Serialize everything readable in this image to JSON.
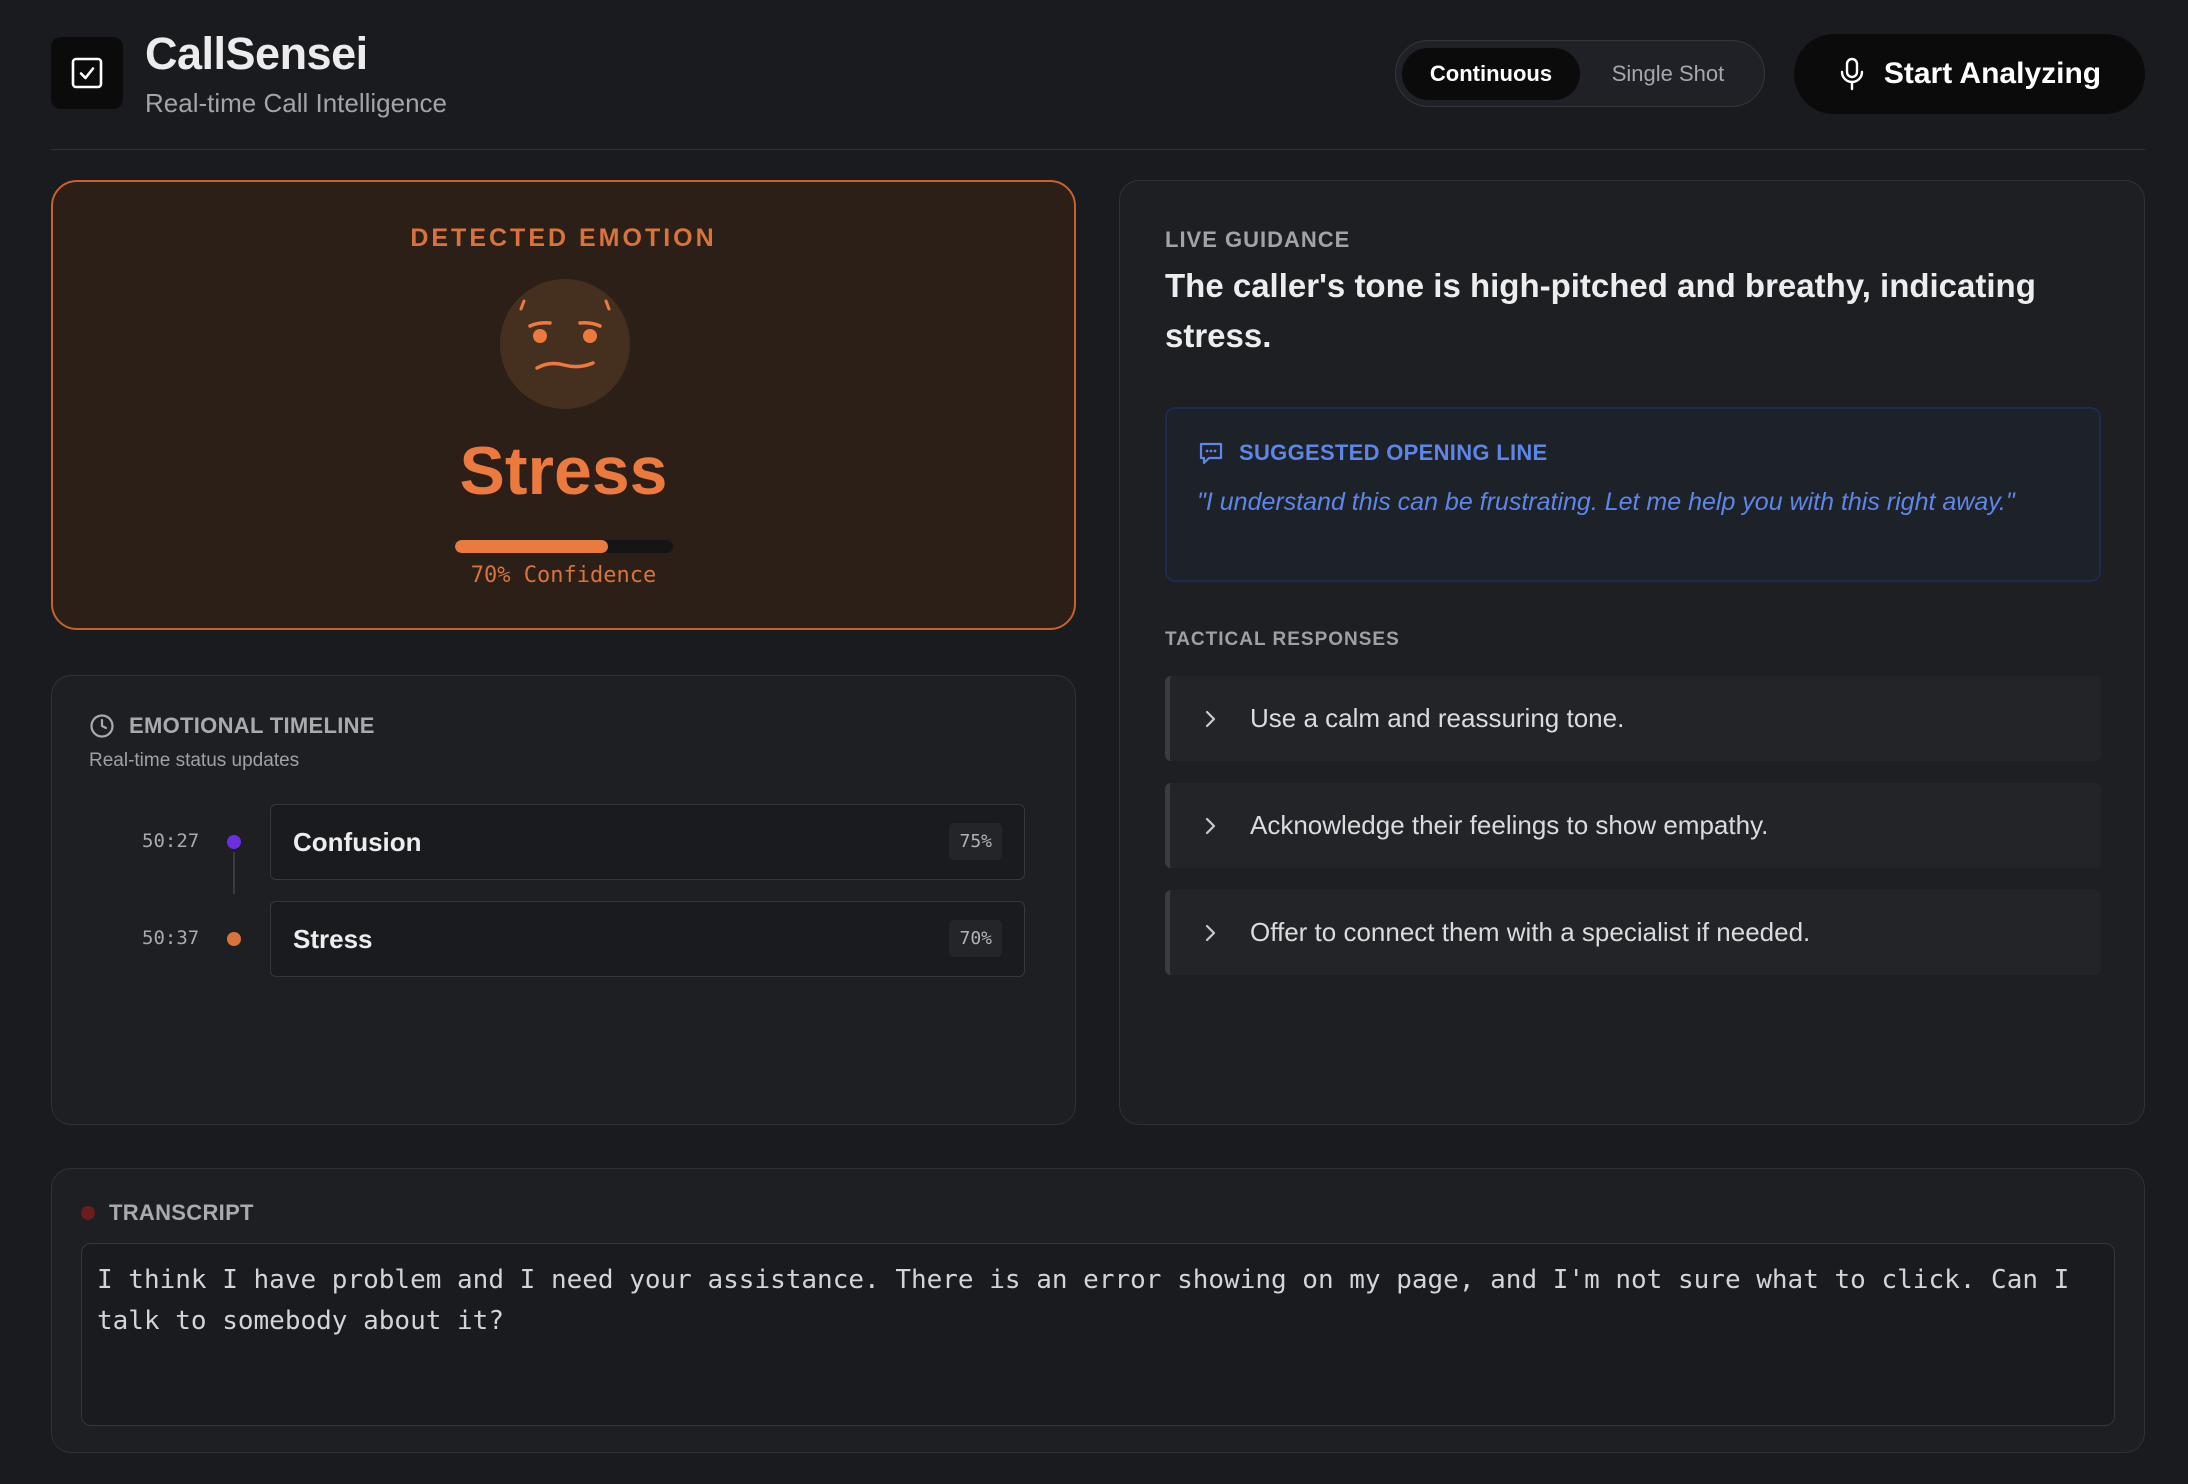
{
  "header": {
    "title": "CallSensei",
    "subtitle": "Real-time Call Intelligence",
    "modes": [
      {
        "label": "Continuous",
        "active": true
      },
      {
        "label": "Single Shot",
        "active": false
      }
    ],
    "start_label": "Start Analyzing"
  },
  "emotion": {
    "label": "DETECTED EMOTION",
    "name": "Stress",
    "confidence": 70,
    "confidence_text": "70% Confidence",
    "accent_color": "#ec7a3f"
  },
  "timeline": {
    "title": "EMOTIONAL TIMELINE",
    "subtitle": "Real-time status updates",
    "entries": [
      {
        "time": "50:27",
        "emotion": "Confusion",
        "pct": "75%",
        "color": "#6a2fe0"
      },
      {
        "time": "50:37",
        "emotion": "Stress",
        "pct": "70%",
        "color": "#d9733c"
      }
    ]
  },
  "guidance": {
    "label": "LIVE GUIDANCE",
    "text": "The caller's tone is high-pitched and breathy, indicating stress.",
    "opening": {
      "title": "SUGGESTED OPENING LINE",
      "quote": "\"I understand this can be frustrating. Let me help you with this right away.\""
    },
    "tactical_label": "TACTICAL RESPONSES",
    "tactical": [
      "Use a calm and reassuring tone.",
      "Acknowledge their feelings to show empathy.",
      "Offer to connect them with a specialist if needed."
    ]
  },
  "transcript": {
    "title": "TRANSCRIPT",
    "text": "I think I have problem and I need your assistance. There is an error showing on my page, and I'm not sure what to click. Can I talk to somebody about it?"
  }
}
